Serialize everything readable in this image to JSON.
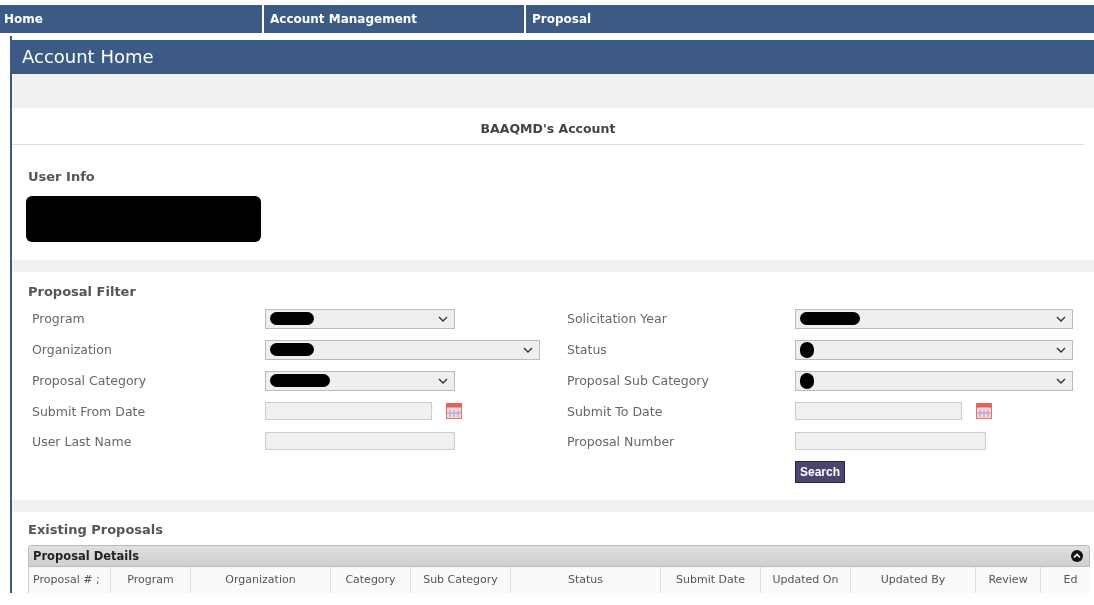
{
  "nav": [
    {
      "label": "Home",
      "selected": false
    },
    {
      "label": "Account Management",
      "selected": false
    },
    {
      "label": "Proposal",
      "selected": false
    }
  ],
  "page_title": "Account Home",
  "account_heading": "BAAQMD's Account",
  "user_info": {
    "title": "User Info",
    "redacted": true
  },
  "filter": {
    "title": "Proposal Filter",
    "left": [
      {
        "label": "Program",
        "kind": "select",
        "redacted": true
      },
      {
        "label": "Organization",
        "kind": "select",
        "redacted": true
      },
      {
        "label": "Proposal Category",
        "kind": "select",
        "redacted": true
      },
      {
        "label": "Submit From Date",
        "kind": "date"
      },
      {
        "label": "User Last Name",
        "kind": "text"
      }
    ],
    "right": [
      {
        "label": "Solicitation Year",
        "kind": "select",
        "redacted": true
      },
      {
        "label": "Status",
        "kind": "select",
        "redacted": true
      },
      {
        "label": "Proposal Sub Category",
        "kind": "select",
        "redacted": true
      },
      {
        "label": "Submit To Date",
        "kind": "date"
      },
      {
        "label": "Proposal Number",
        "kind": "text"
      }
    ],
    "search_button": "Search"
  },
  "existing": {
    "title": "Existing Proposals",
    "panel_title": "Proposal Details",
    "columns": [
      "Proposal # ;",
      "Program",
      "Organization",
      "Category",
      "Sub Category",
      "Status",
      "Submit Date",
      "Updated On",
      "Updated By",
      "Review",
      "Ed"
    ]
  }
}
